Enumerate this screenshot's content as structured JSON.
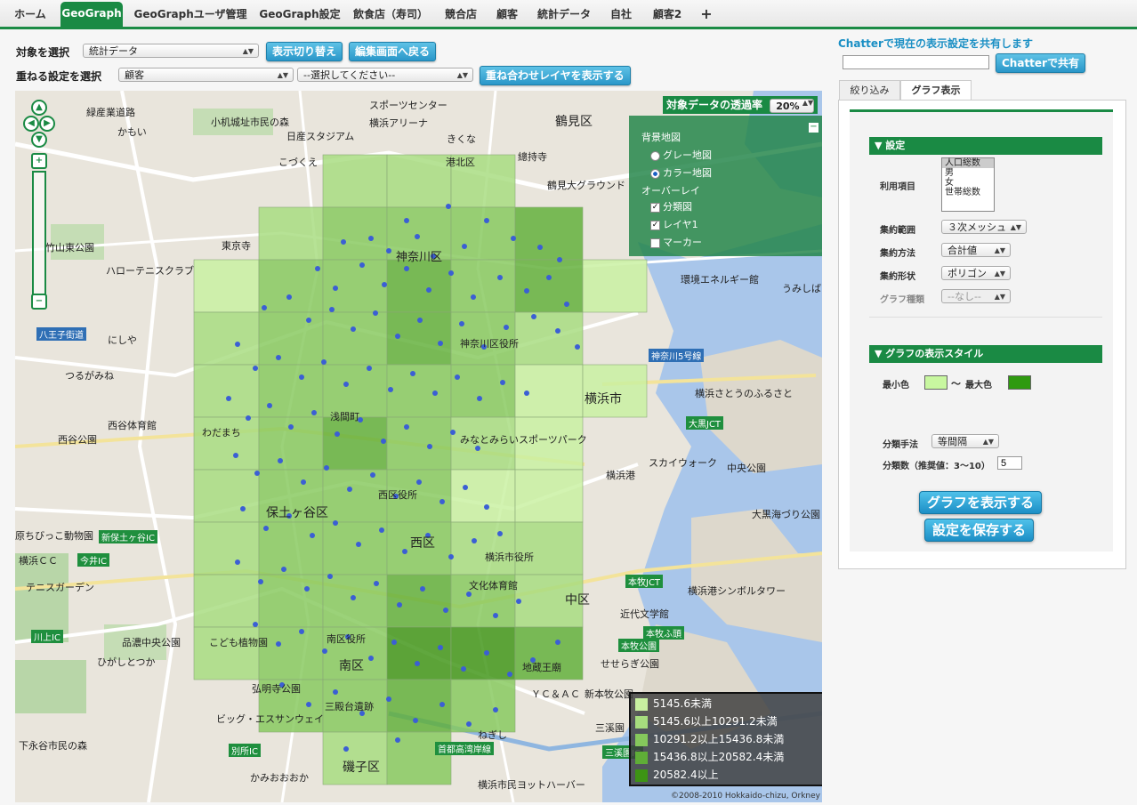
{
  "nav": {
    "tabs": [
      {
        "label": "ホーム",
        "active": false
      },
      {
        "label": "GeoGraph",
        "active": true
      },
      {
        "label": "GeoGraphユーザ管理",
        "active": false
      },
      {
        "label": "GeoGraph設定",
        "active": false
      },
      {
        "label": "飲食店（寿司）",
        "active": false
      },
      {
        "label": "競合店",
        "active": false
      },
      {
        "label": "顧客",
        "active": false
      },
      {
        "label": "統計データ",
        "active": false
      },
      {
        "label": "自社",
        "active": false
      },
      {
        "label": "顧客2",
        "active": false
      }
    ],
    "add_label": "+"
  },
  "controls": {
    "target_label": "対象を選択",
    "target_value": "統計データ",
    "toggle_button": "表示切り替え",
    "back_button": "編集画面へ戻る",
    "overlay_label": "重ねる設定を選択",
    "overlay_value": "顧客",
    "overlay_sub_value": "--選択してください--",
    "show_overlay_button": "重ね合わせレイヤを表示する"
  },
  "map": {
    "opacity_label": "対象データの透過率",
    "opacity_value": "20%",
    "layers": {
      "bg_heading": "背景地図",
      "gray_map": "グレー地図",
      "color_map": "カラー地図",
      "overlay_heading": "オーバーレイ",
      "classification": "分類図",
      "layer1": "レイヤ1",
      "marker": "マーカー",
      "collapse": "−"
    },
    "legend": [
      {
        "label": "5145.6未満",
        "color": "#c8f0a0"
      },
      {
        "label": "5145.6以上10291.2未満",
        "color": "#a6dc7e"
      },
      {
        "label": "10291.2以上15436.8未満",
        "color": "#85c85c"
      },
      {
        "label": "15436.8以上20582.4未満",
        "color": "#5fae37"
      },
      {
        "label": "20582.4以上",
        "color": "#3d9414"
      }
    ],
    "copyright": "©2008-2010 Hokkaido-chizu, Orkney",
    "labels": [
      {
        "t": "緑産業道路"
      },
      {
        "t": "かもい"
      },
      {
        "t": "小机城址市民の森"
      },
      {
        "t": "日産スタジアム"
      },
      {
        "t": "横浜アリーナ"
      },
      {
        "t": "スポーツセンター"
      },
      {
        "t": "鶴見区"
      },
      {
        "t": "こづくえ"
      },
      {
        "t": "港北区"
      },
      {
        "t": "きくな"
      },
      {
        "t": "總持寺"
      },
      {
        "t": "鶴見大グラウンド"
      },
      {
        "t": "東京寺"
      },
      {
        "t": "竹山東公園"
      },
      {
        "t": "ハローテニスクラブ"
      },
      {
        "t": "神奈川区"
      },
      {
        "t": "環境エネルギー館"
      },
      {
        "t": "うみしば"
      },
      {
        "t": "八王子街道"
      },
      {
        "t": "にしや"
      },
      {
        "t": "神奈川区役所"
      },
      {
        "t": "神奈川5号線"
      },
      {
        "t": "つるがみね"
      },
      {
        "t": "横浜市"
      },
      {
        "t": "横浜さとうのふるさと"
      },
      {
        "t": "西谷体育館"
      },
      {
        "t": "浅間町"
      },
      {
        "t": "大黒JCT"
      },
      {
        "t": "わだまち"
      },
      {
        "t": "スカイウォーク"
      },
      {
        "t": "中央公園"
      },
      {
        "t": "みなとみらいスポーツパーク"
      },
      {
        "t": "保土ヶ谷区"
      },
      {
        "t": "西区役所"
      },
      {
        "t": "西区"
      },
      {
        "t": "横浜港"
      },
      {
        "t": "大黒海づり公園"
      },
      {
        "t": "横浜市役所"
      },
      {
        "t": "新保土ヶ谷IC"
      },
      {
        "t": "原ちびっこ動物園"
      },
      {
        "t": "今井IC"
      },
      {
        "t": "横浜ＣＣ"
      },
      {
        "t": "テニスガーデン"
      },
      {
        "t": "文化体育館"
      },
      {
        "t": "中区"
      },
      {
        "t": "本牧JCT"
      },
      {
        "t": "横浜港シンボルタワー"
      },
      {
        "t": "近代文学館"
      },
      {
        "t": "本牧ふ頭"
      },
      {
        "t": "川上IC"
      },
      {
        "t": "こども植物園"
      },
      {
        "t": "南区役所"
      },
      {
        "t": "南区"
      },
      {
        "t": "地蔵王廟"
      },
      {
        "t": "本牧公園"
      },
      {
        "t": "せせらぎ公園"
      },
      {
        "t": "弘明寺公園"
      },
      {
        "t": "ＹＣ＆ＡＣ"
      },
      {
        "t": "新本牧公園"
      },
      {
        "t": "ビッグ・エスサンウェイ"
      },
      {
        "t": "三殿台遺跡"
      },
      {
        "t": "三溪園"
      },
      {
        "t": "下永谷市民の森"
      },
      {
        "t": "別所IC"
      },
      {
        "t": "かみおおおか"
      },
      {
        "t": "磯子区"
      },
      {
        "t": "ねぎし"
      },
      {
        "t": "首都高湾岸線"
      },
      {
        "t": "三溪園IC"
      },
      {
        "t": "横浜市民ヨットハーバー"
      },
      {
        "t": "ひがしとつか"
      },
      {
        "t": "品濃中央公園"
      },
      {
        "t": "西谷公園"
      }
    ]
  },
  "right": {
    "share_title": "Chatterで現在の表示設定を共有します",
    "share_input_value": "",
    "share_button": "Chatterで共有",
    "tab_filter": "絞り込み",
    "tab_graph": "グラフ表示",
    "settings_head": "▼ 設定",
    "field_items": "利用項目",
    "items": [
      "人口総数",
      "男",
      "女",
      "世帯総数"
    ],
    "field_range": "集約範囲",
    "range_value": "３次メッシュ",
    "field_method": "集約方法",
    "method_value": "合計値",
    "field_shape": "集約形状",
    "shape_value": "ポリゴン",
    "field_type": "グラフ種類",
    "type_value": "--なし--",
    "style_head": "▼ グラフの表示スタイル",
    "min_color_label": "最小色",
    "tilde": "〜",
    "max_color_label": "最大色",
    "min_color": "#c8f7a0",
    "max_color": "#2f9a10",
    "field_classify": "分類手法",
    "classify_value": "等間隔",
    "field_count": "分類数（推奨値：3〜10）",
    "count_value": "5",
    "show_graph_button": "グラフを表示する",
    "save_button": "設定を保存する"
  }
}
